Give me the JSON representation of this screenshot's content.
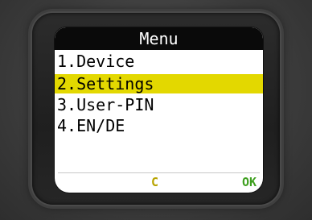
{
  "screen": {
    "title": "Menu"
  },
  "menu": {
    "items": [
      {
        "label": "1.Device",
        "selected": false
      },
      {
        "label": "2.Settings",
        "selected": true
      },
      {
        "label": "3.User-PIN",
        "selected": false
      },
      {
        "label": "4.EN/DE",
        "selected": false
      }
    ]
  },
  "softkeys": {
    "left_label": "C",
    "right_label": "OK"
  },
  "colors": {
    "highlight": "#e3d800",
    "title_bar": "#0a0a0a",
    "softkey_cancel": "#b8a400",
    "softkey_ok": "#3fa020"
  }
}
